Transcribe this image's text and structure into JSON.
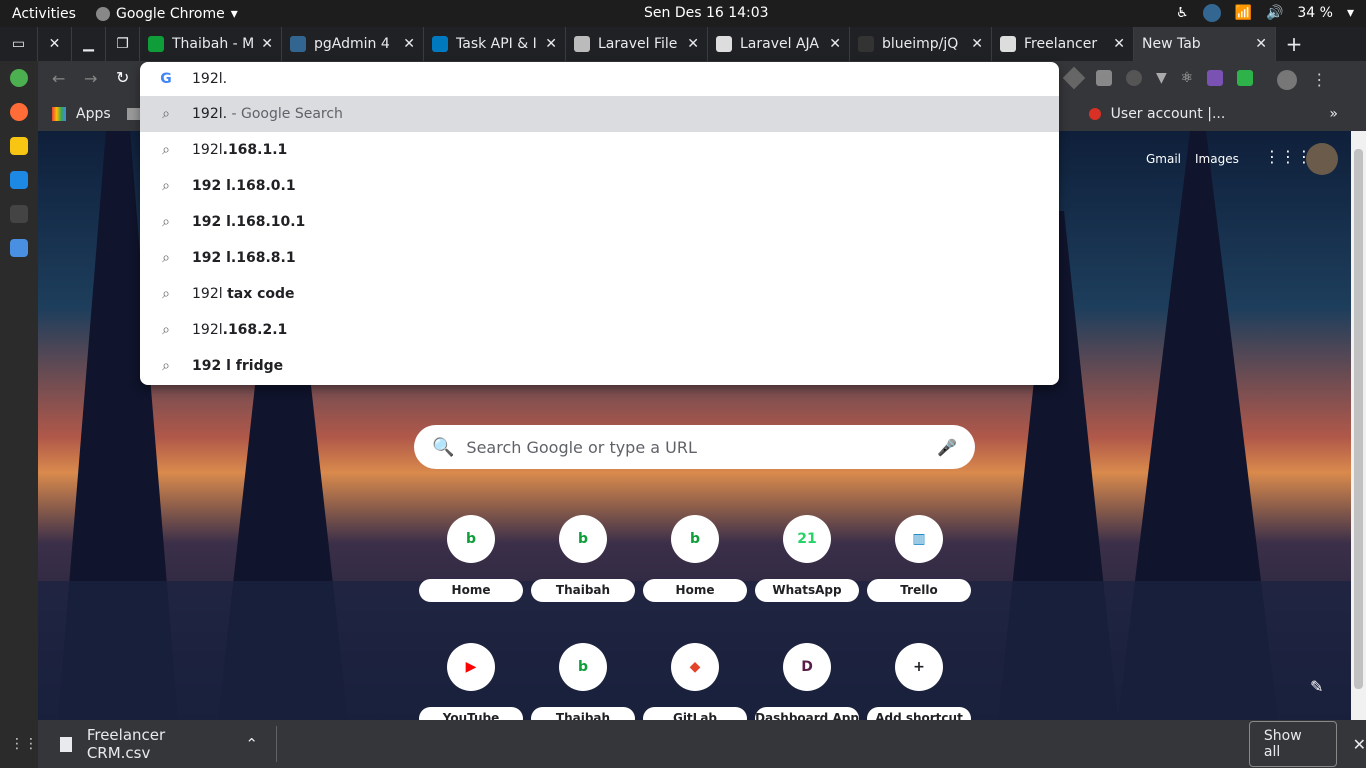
{
  "topbar": {
    "activities": "Activities",
    "app_name": "Google Chrome",
    "clock": "Sen Des 16  14:03",
    "battery": "34 %"
  },
  "tabs": [
    {
      "label": "Thaibah - M",
      "color": "#0f9d3a"
    },
    {
      "label": "pgAdmin 4",
      "color": "#326690"
    },
    {
      "label": "Task API & I",
      "color": "#0079bf"
    },
    {
      "label": "Laravel File",
      "color": "#bbbbbb"
    },
    {
      "label": "Laravel AJA",
      "color": "#dddddd"
    },
    {
      "label": "blueimp/jQ",
      "color": "#333333"
    },
    {
      "label": "Freelancer",
      "color": "#dddddd"
    }
  ],
  "active_tab": {
    "label": "New Tab"
  },
  "omnibox": {
    "query": "192l.",
    "suggestions": [
      {
        "plain": "192l.",
        "bold": "",
        "suffix": " - Google Search"
      },
      {
        "plain": "192l",
        "bold": ".168.1.1",
        "suffix": ""
      },
      {
        "plain": "",
        "bold": "192 l.168.0.1",
        "suffix": ""
      },
      {
        "plain": "",
        "bold": "192 l.168.10.1",
        "suffix": ""
      },
      {
        "plain": "",
        "bold": "192 l.168.8.1",
        "suffix": ""
      },
      {
        "plain": "192l ",
        "bold": "tax code",
        "suffix": ""
      },
      {
        "plain": "192l",
        "bold": ".168.2.1",
        "suffix": ""
      },
      {
        "plain": "",
        "bold": "192 l fridge",
        "suffix": ""
      }
    ]
  },
  "bookmarks": {
    "apps": "Apps",
    "user_account": "User account |...",
    "more": "»"
  },
  "ntp": {
    "gmail": "Gmail",
    "images": "Images",
    "search_placeholder": "Search Google or type a URL",
    "shortcuts_row1": [
      {
        "label": "Home",
        "icon": "b",
        "color": "#0f9d3a"
      },
      {
        "label": "Thaibah",
        "icon": "b",
        "color": "#0f9d3a"
      },
      {
        "label": "Home",
        "icon": "b",
        "color": "#0f9d3a"
      },
      {
        "label": "WhatsApp",
        "icon": "21",
        "color": "#25d366"
      },
      {
        "label": "Trello",
        "icon": "▥",
        "color": "#0079bf"
      }
    ],
    "shortcuts_row2": [
      {
        "label": "YouTube",
        "icon": "▶",
        "color": "#ff0000"
      },
      {
        "label": "Thaibah",
        "icon": "b",
        "color": "#0f9d3a"
      },
      {
        "label": "GitLab",
        "icon": "◆",
        "color": "#e24329"
      },
      {
        "label": "Dashboard App",
        "icon": "D",
        "color": "#5a1d4a"
      },
      {
        "label": "Add shortcut",
        "icon": "+",
        "color": "#202124"
      }
    ]
  },
  "download": {
    "filename": "Freelancer CRM.csv",
    "show_all": "Show all"
  }
}
